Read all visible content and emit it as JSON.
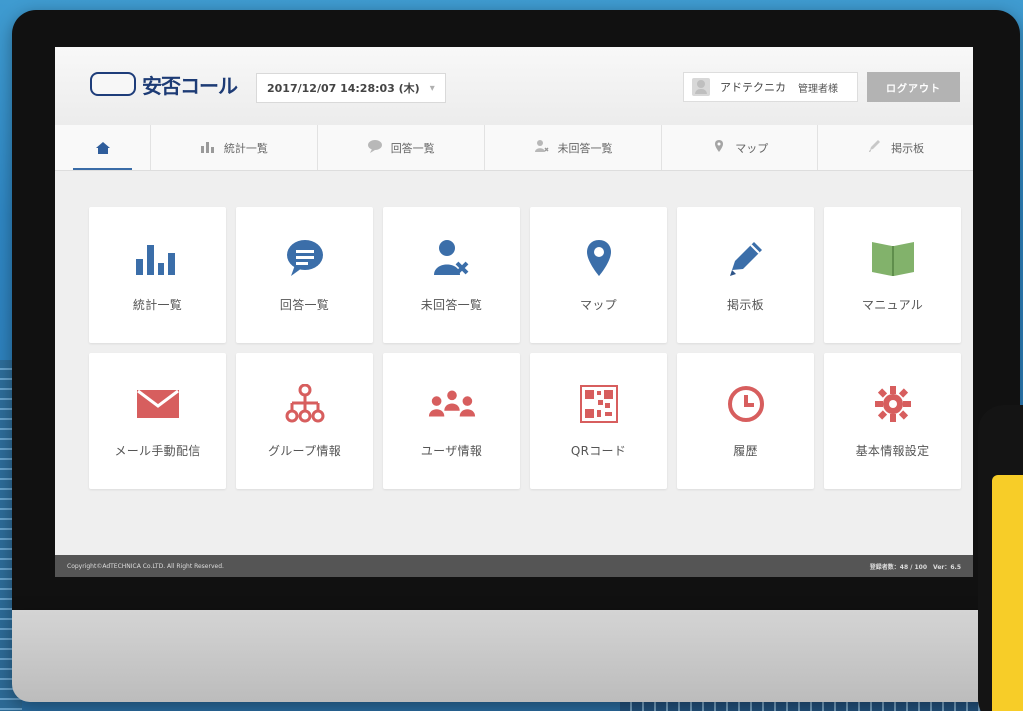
{
  "app": {
    "logo_text": "安否コール",
    "date_display": "2017/12/07 14:28:03 (木)",
    "date_caret": "▾"
  },
  "user": {
    "name": "アドテクニカ",
    "role": "管理者様"
  },
  "header": {
    "logout_label": "ログアウト"
  },
  "nav": {
    "items": [
      {
        "label": "",
        "icon": "home-icon"
      },
      {
        "label": "統計一覧",
        "icon": "stats-icon"
      },
      {
        "label": "回答一覧",
        "icon": "chat-icon"
      },
      {
        "label": "未回答一覧",
        "icon": "user-missing-icon"
      },
      {
        "label": "マップ",
        "icon": "map-pin-icon"
      },
      {
        "label": "掲示板",
        "icon": "pencil-icon"
      }
    ]
  },
  "tiles": [
    {
      "label": "統計一覧",
      "icon": "bar-chart-icon",
      "color": "#3b6ea9"
    },
    {
      "label": "回答一覧",
      "icon": "speech-bubble-icon",
      "color": "#3b6ea9"
    },
    {
      "label": "未回答一覧",
      "icon": "user-x-icon",
      "color": "#3b6ea9"
    },
    {
      "label": "マップ",
      "icon": "location-pin-icon",
      "color": "#3b6ea9"
    },
    {
      "label": "掲示板",
      "icon": "pencil-icon",
      "color": "#3b6ea9"
    },
    {
      "label": "マニュアル",
      "icon": "book-icon",
      "color": "#82b26b"
    },
    {
      "label": "メール手動配信",
      "icon": "envelope-icon",
      "color": "#d75e5e"
    },
    {
      "label": "グループ情報",
      "icon": "group-tree-icon",
      "color": "#d75e5e"
    },
    {
      "label": "ユーザ情報",
      "icon": "users-icon",
      "color": "#d75e5e"
    },
    {
      "label": "QRコード",
      "icon": "qr-code-icon",
      "color": "#d75e5e"
    },
    {
      "label": "履歴",
      "icon": "clock-icon",
      "color": "#d75e5e"
    },
    {
      "label": "基本情報設定",
      "icon": "gear-icon",
      "color": "#d75e5e"
    }
  ],
  "footer": {
    "copyright": "Copyright©AdTECHNICA Co.LTD. All Right Reserved.",
    "count_label": "登録者数：48 / 100",
    "version": "Ver：6.5"
  }
}
